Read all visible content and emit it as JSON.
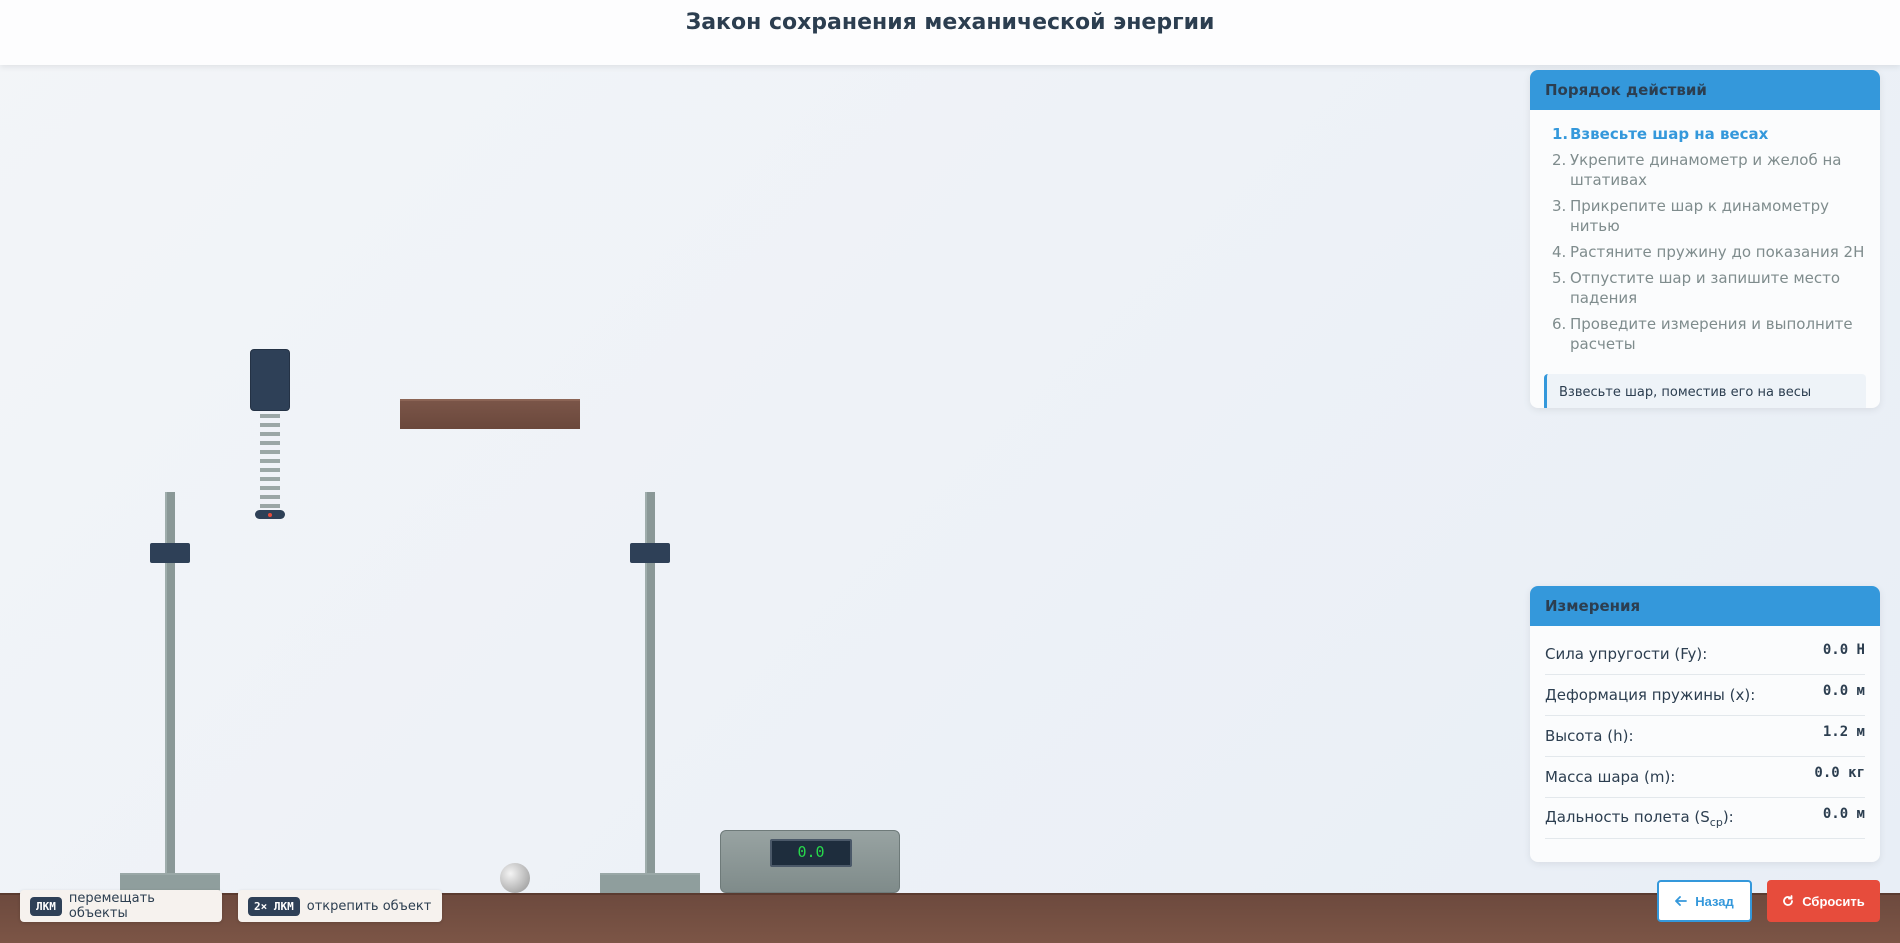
{
  "header": {
    "title": "Закон сохранения механической энергии"
  },
  "scale": {
    "reading": "0.0"
  },
  "hints": [
    {
      "key": "ЛКМ",
      "text": "перемещать объекты"
    },
    {
      "key": "2× ЛКМ",
      "text": "открепить объект"
    }
  ],
  "steps_panel": {
    "title": "Порядок действий",
    "items": [
      {
        "num": "1.",
        "text": "Взвесьте шар на весах"
      },
      {
        "num": "2.",
        "text": "Укрепите динамометр и желоб на штативах"
      },
      {
        "num": "3.",
        "text": "Прикрепите шар к динамометру нитью"
      },
      {
        "num": "4.",
        "text": "Растяните пружину до показания 2Н"
      },
      {
        "num": "5.",
        "text": "Отпустите шар и запишите место падения"
      },
      {
        "num": "6.",
        "text": "Проведите измерения и выполните расчеты"
      }
    ],
    "active_index": 0,
    "note": "Взвесьте шар, поместив его на весы"
  },
  "measurements_panel": {
    "title": "Измерения",
    "rows": [
      {
        "label": "Сила упругости (Fy):",
        "value": "0.0 Н"
      },
      {
        "label": "Деформация пружины (x):",
        "value": "0.0 м"
      },
      {
        "label": "Высота (h):",
        "value": "1.2 м"
      },
      {
        "label": "Масса шара (m):",
        "value": "0.0 кг"
      },
      {
        "label": "Дальность полета (S",
        "label_sub": "ср",
        "label_end": "):",
        "value": "0.0 м"
      }
    ]
  },
  "buttons": {
    "back": "Назад",
    "reset": "Сбросить"
  },
  "colors": {
    "accent": "#3498db",
    "danger": "#e74c3c",
    "dark": "#2e4057",
    "floor": "#6d4a3e"
  },
  "icons": {
    "back": "arrow-left-icon",
    "reset": "reset-icon"
  }
}
